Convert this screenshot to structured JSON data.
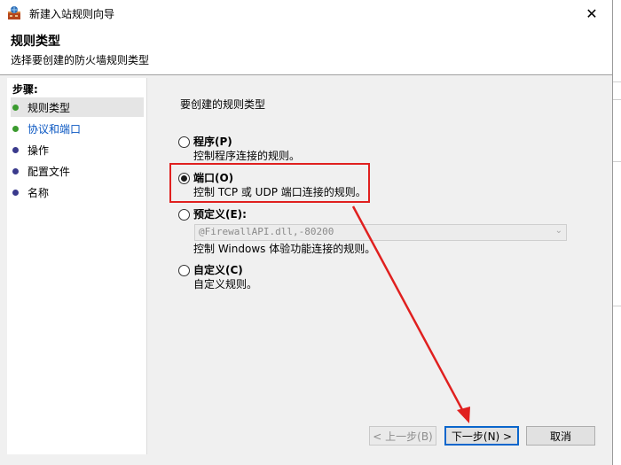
{
  "window": {
    "title": "新建入站规则向导",
    "close_glyph": "✕"
  },
  "header": {
    "title": "规则类型",
    "subtitle": "选择要创建的防火墙规则类型"
  },
  "steps": {
    "title": "步骤:",
    "items": [
      {
        "label": "规则类型",
        "state": "current",
        "dot": "green"
      },
      {
        "label": "协议和端口",
        "state": "link",
        "dot": "green"
      },
      {
        "label": "操作",
        "state": "normal",
        "dot": "purple"
      },
      {
        "label": "配置文件",
        "state": "normal",
        "dot": "purple"
      },
      {
        "label": "名称",
        "state": "normal",
        "dot": "purple"
      }
    ]
  },
  "content": {
    "prompt": "要创建的规则类型",
    "options": [
      {
        "label": "程序(P)",
        "desc": "控制程序连接的规则。",
        "checked": false
      },
      {
        "label": "端口(O)",
        "desc": "控制 TCP 或 UDP 端口连接的规则。",
        "checked": true
      },
      {
        "label": "预定义(E):",
        "desc": "控制 Windows 体验功能连接的规则。",
        "checked": false,
        "select_value": "@FirewallAPI.dll,-80200"
      },
      {
        "label": "自定义(C)",
        "desc": "自定义规则。",
        "checked": false
      }
    ]
  },
  "buttons": {
    "back": "< 上一步(B)",
    "next": "下一步(N) >",
    "cancel": "取消"
  },
  "colors": {
    "annotation_red": "#e0201f",
    "accent_blue": "#0a66cc",
    "step_green": "#3a9a2e",
    "step_purple": "#3a3a8c"
  }
}
